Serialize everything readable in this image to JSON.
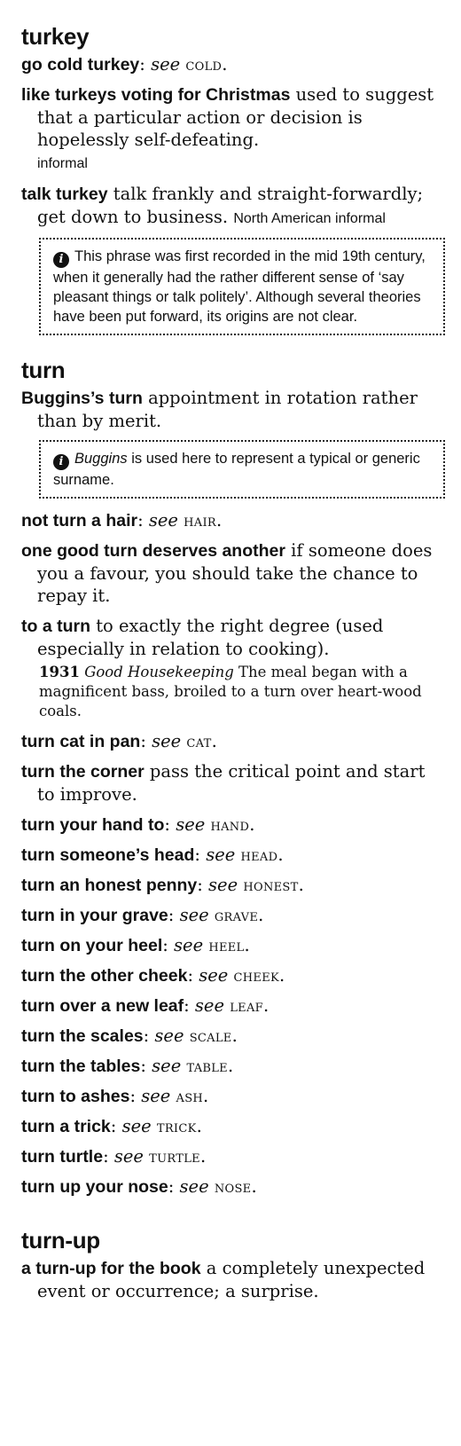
{
  "sections": [
    {
      "headword": "turkey",
      "entries": [
        {
          "phrase": "go cold turkey",
          "see": "see",
          "ref": "cold"
        },
        {
          "phrase": "like turkeys voting for Christmas",
          "def": "used to suggest that a particular action or decision is hopelessly self-defeating.",
          "label": "informal"
        },
        {
          "phrase": "talk turkey",
          "def": "talk frankly and straight-forwardly; get down to business.",
          "label": "North American informal"
        }
      ],
      "note": {
        "text": "This phrase was first recorded in the mid 19th century, when it generally had the rather different sense of ‘say pleasant things or talk politely’. Although several theories have been put forward, its origins are not clear."
      }
    },
    {
      "headword": "turn",
      "entries": [
        {
          "phrase": "Buggins’s turn",
          "def": "appointment in rotation rather than by merit."
        },
        {
          "phrase": "not turn a hair",
          "see": "see",
          "ref": "hair"
        },
        {
          "phrase": "one good turn deserves another",
          "def": "if someone does you a favour, you should take the chance to repay it."
        },
        {
          "phrase": "to a turn",
          "def": "to exactly the right degree (used especially in relation to cooking)."
        },
        {
          "phrase": "turn cat in pan",
          "see": "see",
          "ref": "cat"
        },
        {
          "phrase": "turn the corner",
          "def": "pass the critical point and start to improve."
        },
        {
          "phrase": "turn your hand to",
          "see": "see",
          "ref": "hand"
        },
        {
          "phrase": "turn someone’s head",
          "see": "see",
          "ref": "head"
        },
        {
          "phrase": "turn an honest penny",
          "see": "see",
          "ref": "honest"
        },
        {
          "phrase": "turn in your grave",
          "see": "see",
          "ref": "grave"
        },
        {
          "phrase": "turn on your heel",
          "see": "see",
          "ref": "heel"
        },
        {
          "phrase": "turn the other cheek",
          "see": "see",
          "ref": "cheek"
        },
        {
          "phrase": "turn over a new leaf",
          "see": "see",
          "ref": "leaf"
        },
        {
          "phrase": "turn the scales",
          "see": "see",
          "ref": "scale"
        },
        {
          "phrase": "turn the tables",
          "see": "see",
          "ref": "table"
        },
        {
          "phrase": "turn to ashes",
          "see": "see",
          "ref": "ash"
        },
        {
          "phrase": "turn a trick",
          "see": "see",
          "ref": "trick"
        },
        {
          "phrase": "turn turtle",
          "see": "see",
          "ref": "turtle"
        },
        {
          "phrase": "turn up your nose",
          "see": "see",
          "ref": "nose"
        }
      ],
      "note": {
        "term": "Buggins",
        "text": "is used here to represent a typical or generic surname."
      },
      "quote": {
        "year": "1931",
        "source": "Good Housekeeping",
        "text": "The meal began with a magnificent bass, broiled to a turn over heart-wood coals."
      }
    },
    {
      "headword": "turn-up",
      "entries": [
        {
          "phrase": "a turn-up for the book",
          "def": "a completely unexpected event or occurrence; a surprise."
        }
      ]
    }
  ]
}
